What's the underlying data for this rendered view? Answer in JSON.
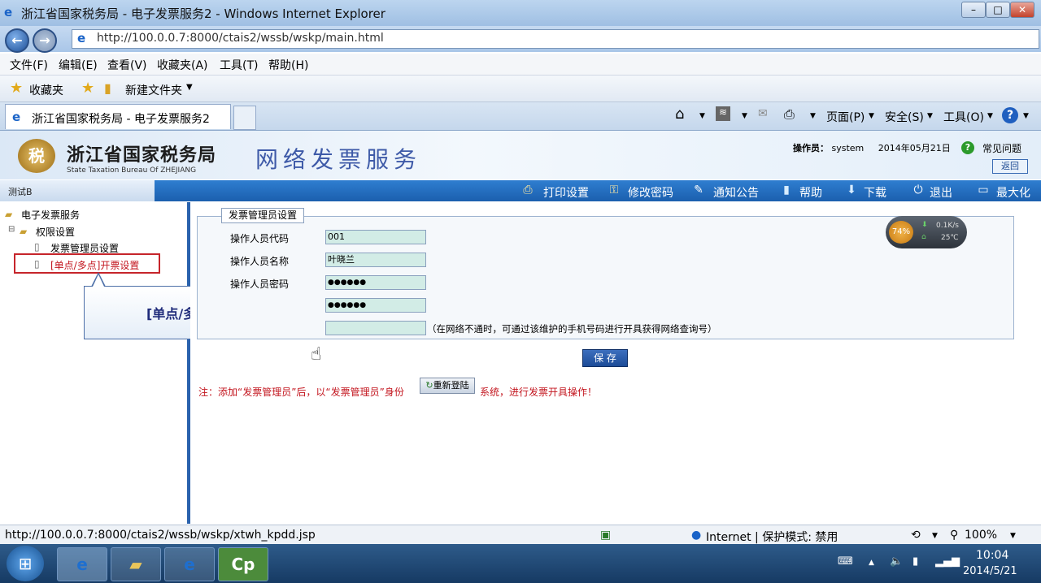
{
  "window": {
    "title": "浙江省国家税务局 - 电子发票服务2 - Windows Internet Explorer"
  },
  "address": {
    "url": "http://100.0.0.7:8000/ctais2/wssb/wskp/main.html"
  },
  "menu": [
    "文件(F)",
    "编辑(E)",
    "查看(V)",
    "收藏夹(A)",
    "工具(T)",
    "帮助(H)"
  ],
  "favorites": {
    "label": "收藏夹",
    "new_folder": "新建文件夹"
  },
  "tab": {
    "title": "浙江省国家税务局 - 电子发票服务2"
  },
  "commandbar": {
    "page": "页面(P)",
    "safety": "安全(S)",
    "tools": "工具(O)"
  },
  "header": {
    "org_name": "浙江省国家税务局",
    "org_english": "State Taxation Bureau Of ZHEJIANG",
    "service_name": "网络发票服务",
    "operator_label": "操作员：",
    "operator": "system",
    "date": "2014年05月21日",
    "faq": "常见问题",
    "back": "返回"
  },
  "navbar": {
    "user": "测试B",
    "items": [
      "打印设置",
      "修改密码",
      "通知公告",
      "帮助",
      "下载",
      "退出",
      "最大化"
    ]
  },
  "tree": {
    "root": "电子发票服务",
    "group": "权限设置",
    "items": [
      "发票管理员设置",
      "[单点/多点]开票设置"
    ]
  },
  "callout": {
    "text": "[单点/多点]开票设置"
  },
  "form": {
    "legend": "发票管理员设置",
    "labels": [
      "操作人员代码",
      "操作人员名称",
      "操作人员密码"
    ],
    "values": {
      "code": "001",
      "name": "叶晓兰",
      "password": "●●●●●●",
      "password2": "●●●●●●",
      "phone": ""
    },
    "hint": "（在网络不通时，可通过该维护的手机号码进行开具获得网络查询号）",
    "save": "保 存",
    "note": "注：添加“发票管理员”后，以“发票管理员”身份",
    "relogin": "重新登陆",
    "note2": "系统，进行发票开具操作！"
  },
  "gauge": {
    "percent": "74%",
    "speed": "0.1K/s",
    "temp": "25℃"
  },
  "status": {
    "url": "http://100.0.0.7:8000/ctais2/wssb/wskp/xtwh_kpdd.jsp",
    "zone": "Internet | 保护模式: 禁用",
    "zoom": "100%"
  },
  "taskbar": {
    "time": "10:04",
    "date": "2014/5/21"
  }
}
